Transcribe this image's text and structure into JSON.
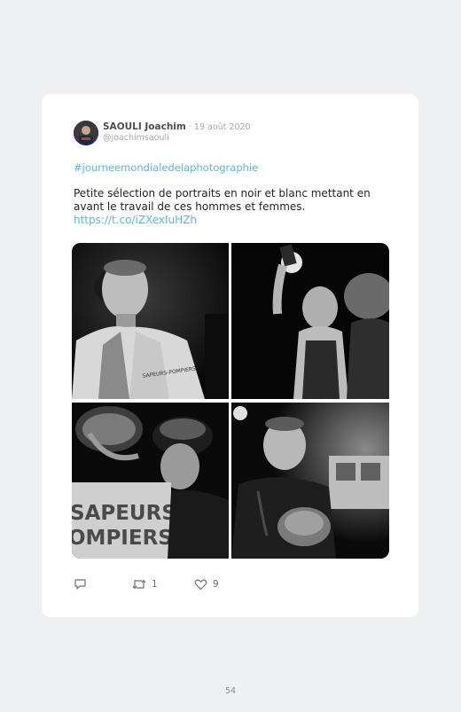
{
  "tweet": {
    "author_name": "SAOULI Joachim",
    "date": " · 19 août 2020",
    "handle": "@joachimsaouli",
    "hashtag": "#journeemondialedelaphotographie",
    "text": "Petite sélection de portraits en noir et blanc mettant en avant le travail de ces hommes et femmes.",
    "link": "https://t.co/iZXexIuHZh",
    "photos": [
      {
        "caption": "Portrait of a man in a reflective vest",
        "vest_text": "SAPEURS-POMPIERS"
      },
      {
        "caption": "Firefighter raising a flashlight at night"
      },
      {
        "caption": "Firefighters with helmets, back text",
        "back_text_1": "SAPEURS",
        "back_text_2": "OMPIERS"
      },
      {
        "caption": "Firefighter officer at night near truck"
      }
    ],
    "actions": {
      "reply_icon": "reply-icon",
      "retweet_icon": "retweet-icon",
      "retweet_count": "1",
      "like_icon": "heart-icon",
      "like_count": "9"
    },
    "colors": {
      "link": "#5ab5e8",
      "page_bg": "#eef0f2",
      "card_bg": "#ffffff"
    }
  },
  "page": {
    "number": "54"
  }
}
